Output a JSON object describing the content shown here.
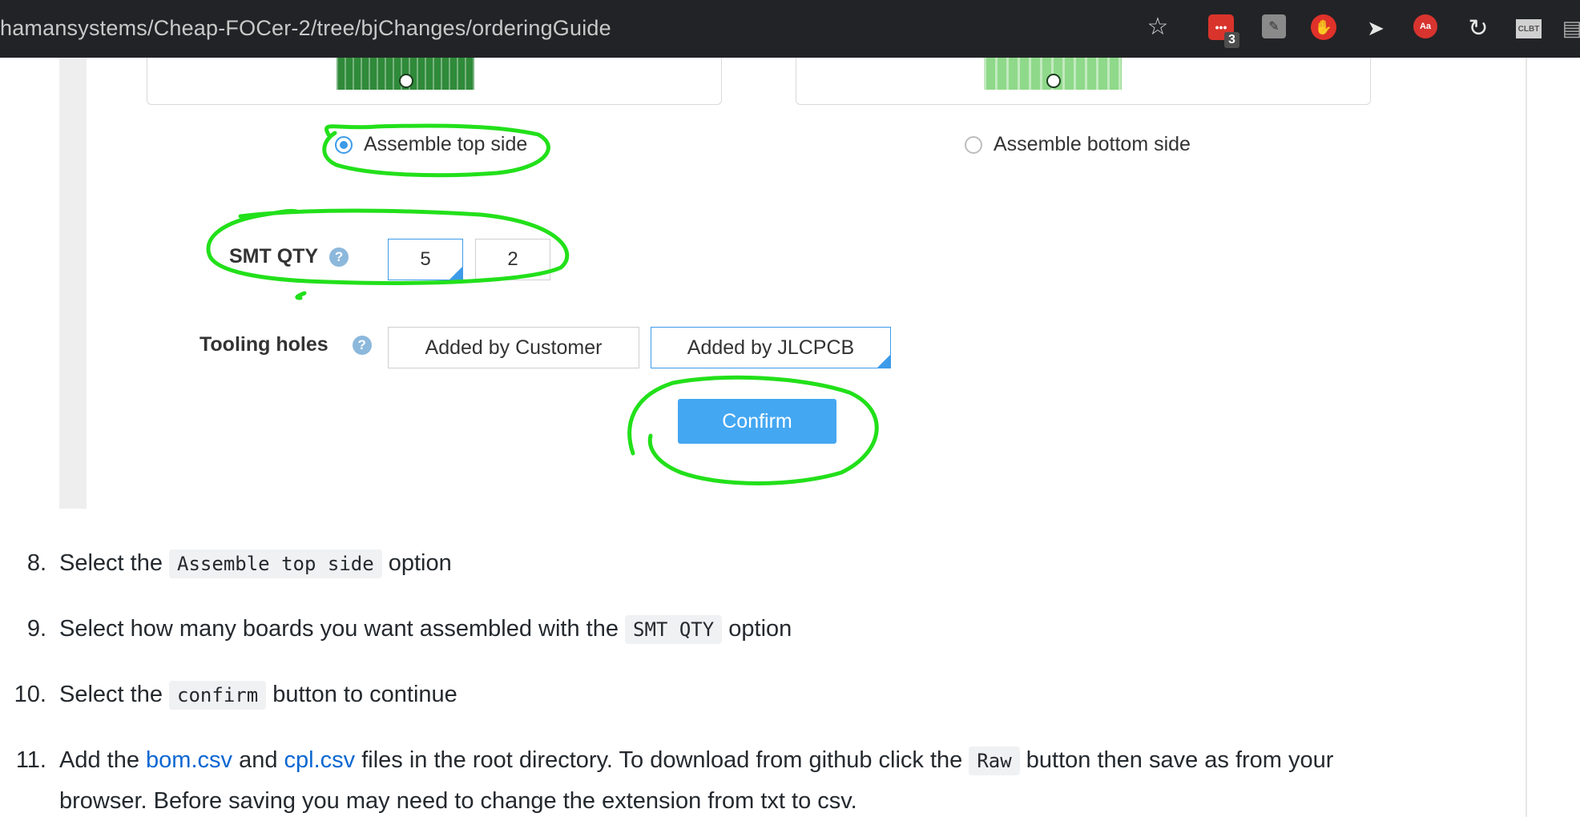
{
  "browser": {
    "url": "hamansystems/Cheap-FOCer-2/tree/bjChanges/orderingGuide",
    "extension_badge": "3",
    "extensions": [
      "bookmark-star-icon",
      "extension-red-dots-icon",
      "extension-gray-icon",
      "extension-stop-hand-icon",
      "extension-cursor-icon",
      "extension-aa-icon",
      "extension-refresh-icon",
      "extension-clbt-icon",
      "extension-partial-icon"
    ]
  },
  "assembly_form": {
    "radio_top_label": "Assemble top side",
    "radio_bottom_label": "Assemble bottom side",
    "selected_side": "top",
    "smt_qty_label": "SMT QTY",
    "smt_qty_options": [
      "5",
      "2"
    ],
    "smt_qty_selected": "5",
    "tooling_holes_label": "Tooling holes",
    "tooling_options": [
      "Added by Customer",
      "Added by JLCPCB"
    ],
    "tooling_selected": "Added by JLCPCB",
    "confirm_label": "Confirm",
    "help_glyph": "?"
  },
  "steps": [
    {
      "number": "8.",
      "pre": "Select the ",
      "code": "Assemble top side",
      "post": " option"
    },
    {
      "number": "9.",
      "pre": "Select how many boards you want assembled with the ",
      "code": "SMT QTY",
      "post": " option"
    },
    {
      "number": "10.",
      "pre": "Select the ",
      "code": "confirm",
      "post": " button to continue"
    },
    {
      "number": "11.",
      "pre": "Add the ",
      "link1": "bom.csv",
      "mid1": " and ",
      "link2": "cpl.csv",
      "mid2": " files in the root directory. To download from github click the ",
      "code": "Raw",
      "post": " button then save as from your",
      "line2": "browser. Before saving you may need to change the extension from txt to csv."
    }
  ],
  "colors": {
    "annotation": "#22e01a",
    "accent": "#44a7f2",
    "link": "#0b67d2"
  }
}
